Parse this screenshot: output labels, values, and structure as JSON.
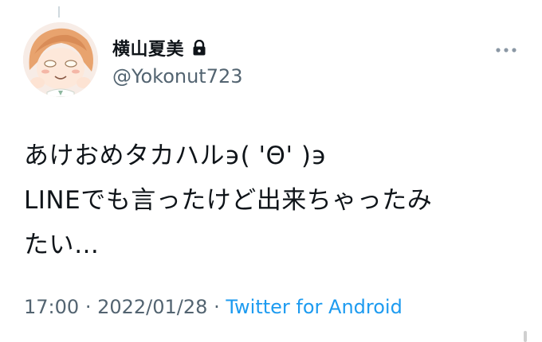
{
  "user": {
    "display_name": "横山夏美",
    "handle": "@Yokonut723",
    "avatar_icon": "anime-avatar",
    "protected_icon": "lock-icon"
  },
  "tweet": {
    "lines": [
      "あけおめタカハル϶( 'Θ' )϶",
      "LINEでも言ったけど出来ちゃったみ",
      "たい…"
    ]
  },
  "meta": {
    "time": "17:00",
    "separator": "·",
    "date": "2022/01/28",
    "source": "Twitter for Android"
  },
  "colors": {
    "text": "#0f1419",
    "secondary": "#536471",
    "link": "#1d9bf0"
  }
}
